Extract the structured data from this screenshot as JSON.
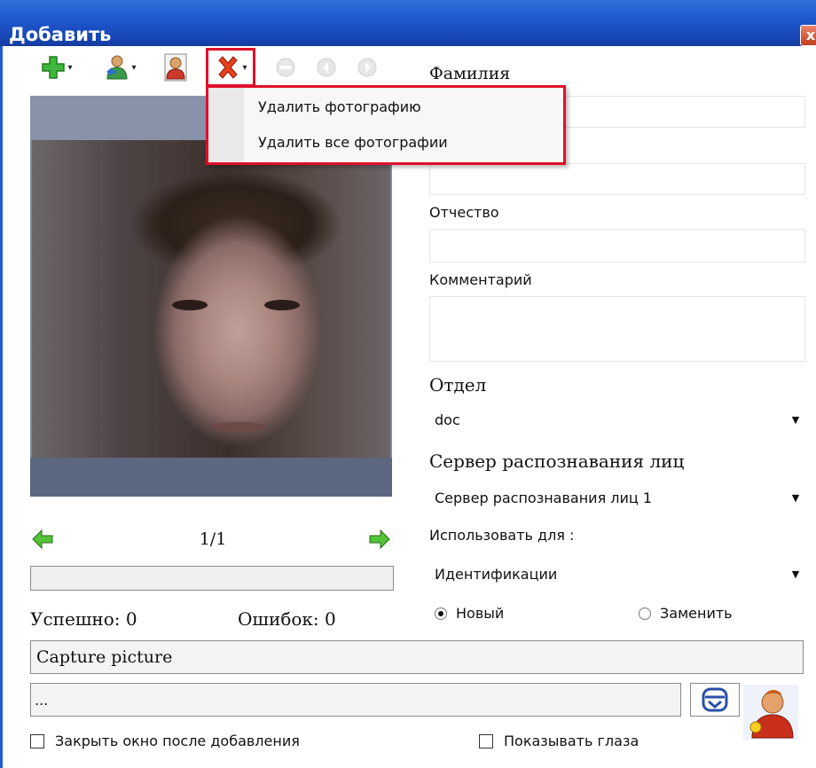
{
  "window": {
    "title": "Добавить",
    "close_glyph": "x"
  },
  "toolbar": {
    "buttons": [
      {
        "icon": "add-icon",
        "has_dropdown": true
      },
      {
        "icon": "user-import-icon",
        "has_dropdown": true
      },
      {
        "icon": "user-photo-icon",
        "has_dropdown": false
      },
      {
        "icon": "delete-icon",
        "has_dropdown": true,
        "highlighted": true
      },
      {
        "icon": "minus-icon",
        "disabled": true
      },
      {
        "icon": "rotate-left-icon",
        "disabled": true
      },
      {
        "icon": "rotate-right-icon",
        "disabled": true
      }
    ]
  },
  "delete_menu": {
    "items": [
      "Удалить фотографию",
      "Удалить все фотографии"
    ]
  },
  "photo": {
    "counter": "1/1"
  },
  "stats": {
    "success_label": "Успешно: 0",
    "errors_label": "Ошибок: 0"
  },
  "form": {
    "surname_label": "Фамилия",
    "surname_value": "",
    "name_value": "",
    "patronymic_label": "Отчество",
    "patronymic_value": "",
    "comment_label": "Комментарий",
    "comment_value": "",
    "department_label": "Отдел",
    "department_value": "doc",
    "server_label": "Сервер распознавания лиц",
    "server_value": "Сервер распознавания лиц 1",
    "use_for_label": "Использовать для :",
    "use_for_value": "Идентификации",
    "radio_new": "Новый",
    "radio_replace": "Заменить",
    "radio_selected": "new"
  },
  "status": {
    "capture_text": "Capture picture",
    "path_text": "..."
  },
  "options": {
    "close_after_add": "Закрыть окно после добавления",
    "show_eyes": "Показывать глаза"
  },
  "colors": {
    "title_bar": "#1f5bd0",
    "highlight_border": "#e0102a",
    "photo_bg": "#7e8aa0"
  }
}
